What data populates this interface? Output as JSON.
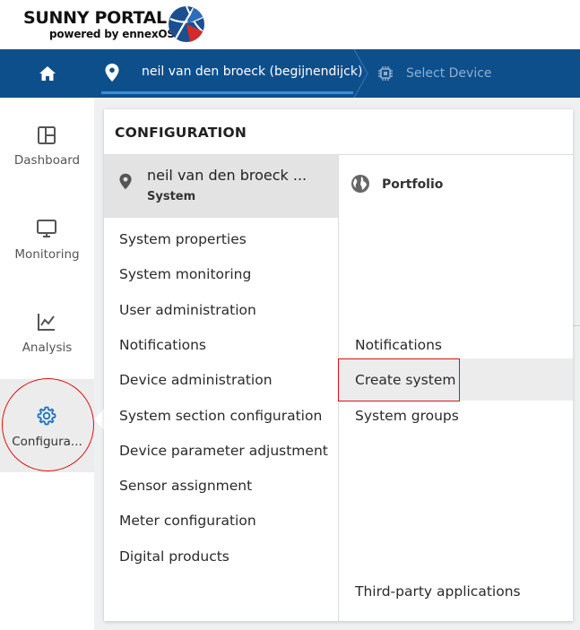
{
  "brand": {
    "name": "SUNNY PORTAL",
    "sub": "powered by ennexOS"
  },
  "nav": {
    "site_label": "neil van den broeck (begijnendijck)",
    "device_label": "Select Device"
  },
  "sidebar": {
    "items": [
      {
        "label": "Dashboard",
        "icon": "dashboard-icon"
      },
      {
        "label": "Monitoring",
        "icon": "monitor-icon"
      },
      {
        "label": "Analysis",
        "icon": "chart-line-icon"
      },
      {
        "label": "Configura...",
        "icon": "gear-icon"
      }
    ]
  },
  "flyout": {
    "title": "CONFIGURATION",
    "site_card": {
      "name": "neil van den broeck ...",
      "kind": "System"
    },
    "left_items": [
      "System properties",
      "System monitoring",
      "User administration",
      "Notifications",
      "Device administration",
      "System section configuration",
      "Device parameter adjustment",
      "Sensor assignment",
      "Meter configuration",
      "Digital products"
    ],
    "portfolio_label": "Portfolio",
    "right_items": [
      "Notifications",
      "Create system",
      "System groups",
      "Third-party applications"
    ]
  },
  "colors": {
    "nav_bg": "#0d4f8b",
    "accent": "#3c8fd6",
    "gear_active": "#1e73be",
    "highlight_outline": "#dd1111"
  }
}
